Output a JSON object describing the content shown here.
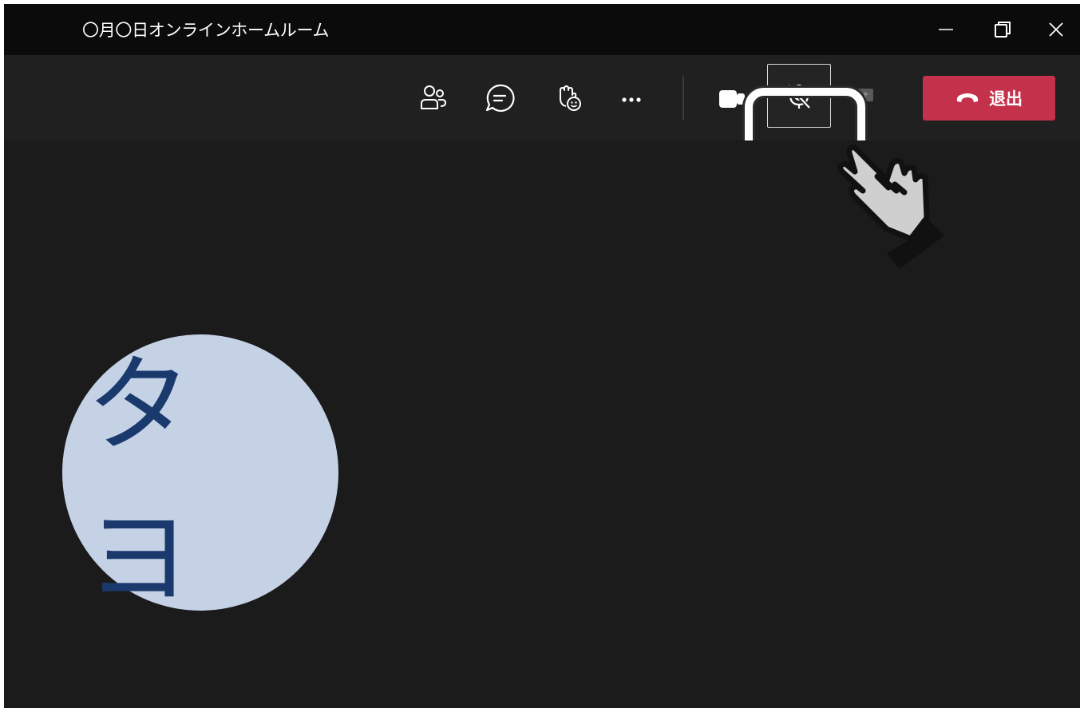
{
  "window": {
    "title": "〇月〇日オンラインホームルーム"
  },
  "toolbar": {
    "buttons": [
      {
        "name": "participants",
        "icon": "people-icon"
      },
      {
        "name": "chat",
        "icon": "chat-icon"
      },
      {
        "name": "reactions",
        "icon": "raise-hand-icon"
      },
      {
        "name": "more",
        "icon": "more-icon"
      },
      {
        "name": "camera",
        "icon": "camera-icon"
      },
      {
        "name": "mic",
        "icon": "mic-muted-icon"
      },
      {
        "name": "share",
        "icon": "share-icon"
      }
    ],
    "leave_label": "退出"
  },
  "participant": {
    "initials": "タ ヨ"
  },
  "colors": {
    "leave": "#c4314b",
    "avatar_bg": "#c5d2e6",
    "avatar_text": "#1a3a6d"
  }
}
